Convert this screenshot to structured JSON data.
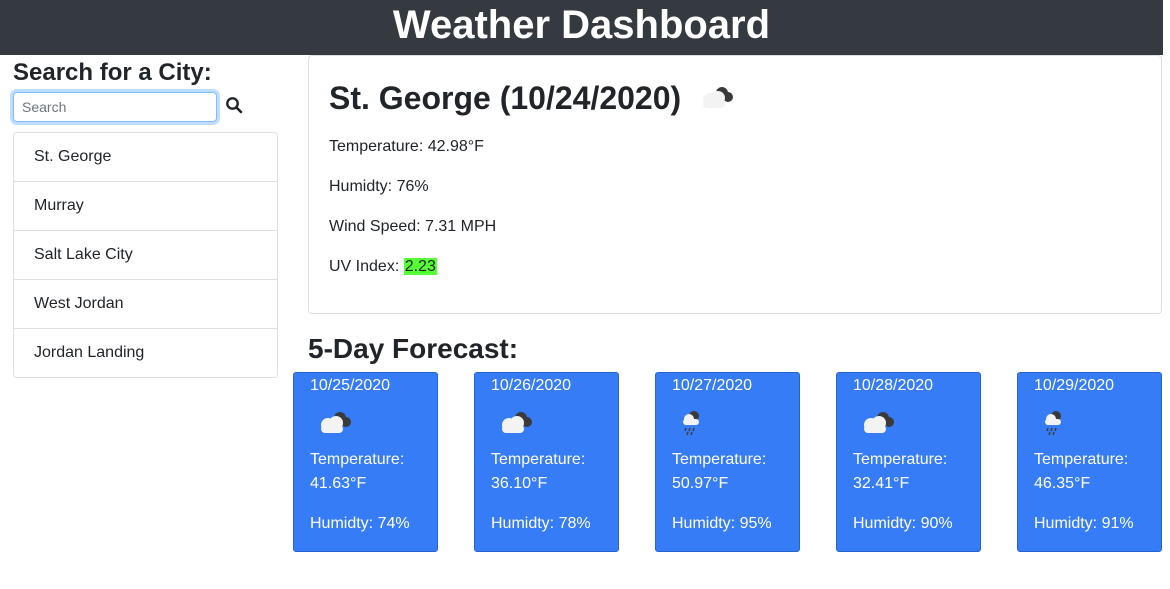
{
  "header": {
    "title": "Weather Dashboard"
  },
  "sidebar": {
    "heading": "Search for a City:",
    "search_placeholder": "Search",
    "cities": [
      "St. George",
      "Murray",
      "Salt Lake City",
      "West Jordan",
      "Jordan Landing"
    ]
  },
  "current": {
    "title": "St. George (10/24/2020)",
    "icon": "clouds-icon",
    "temperature": "Temperature: 42.98°F",
    "humidity": "Humidty: 76%",
    "wind": "Wind Speed: 7.31 MPH",
    "uv_label": "UV Index: ",
    "uv_value": "2.23",
    "uv_color": "#55ff33"
  },
  "forecast": {
    "heading": "5-Day Forecast:",
    "days": [
      {
        "date": "10/25/2020",
        "icon": "clouds-icon",
        "temp_label": "Temperature:",
        "temp": "41.63°F",
        "humidity": "Humidty: 74%"
      },
      {
        "date": "10/26/2020",
        "icon": "clouds-icon",
        "temp_label": "Temperature:",
        "temp": "36.10°F",
        "humidity": "Humidty: 78%"
      },
      {
        "date": "10/27/2020",
        "icon": "rain-icon",
        "temp_label": "Temperature:",
        "temp": "50.97°F",
        "humidity": "Humidty: 95%"
      },
      {
        "date": "10/28/2020",
        "icon": "clouds-icon",
        "temp_label": "Temperature:",
        "temp": "32.41°F",
        "humidity": "Humidty: 90%"
      },
      {
        "date": "10/29/2020",
        "icon": "rain-icon",
        "temp_label": "Temperature:",
        "temp": "46.35°F",
        "humidity": "Humidty: 91%"
      }
    ],
    "card_color": "#367cf7"
  },
  "colors": {
    "header_bg": "#343a40"
  }
}
